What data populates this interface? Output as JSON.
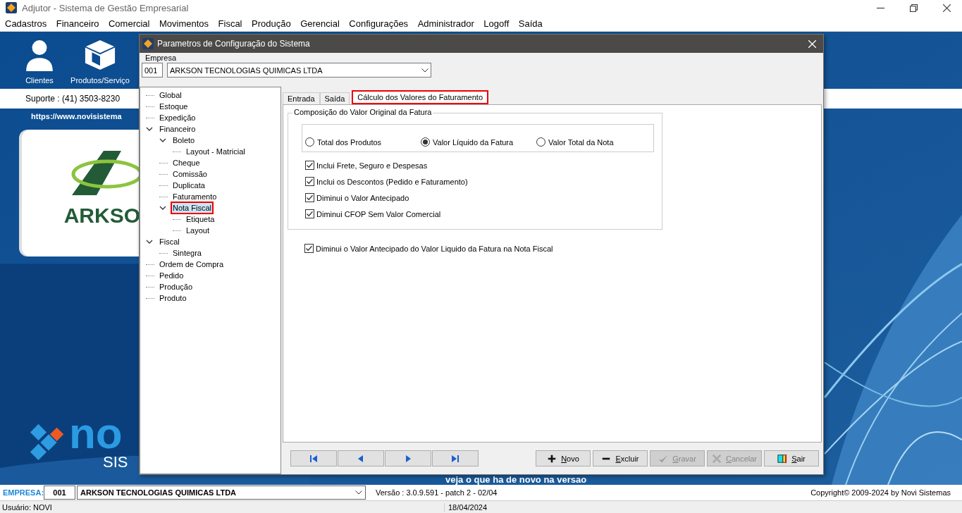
{
  "window": {
    "title": "Adjutor - Sistema de Gestão Empresarial"
  },
  "menu": [
    "Cadastros",
    "Financeiro",
    "Comercial",
    "Movimentos",
    "Fiscal",
    "Produção",
    "Gerencial",
    "Configurações",
    "Administrador",
    "Logoff",
    "Saída"
  ],
  "toolbar": [
    {
      "label": "Clientes",
      "kind": "person"
    },
    {
      "label": "Produtos/Serviço",
      "kind": "box"
    }
  ],
  "support": "Suporte : (41) 3503-8230",
  "website": "https://www.novisistema",
  "client_logo": {
    "text": "ARKSO"
  },
  "brand_logo": {
    "text": "no",
    "subtext": "SIS"
  },
  "news_link": "veja o que ha de novo na versao",
  "dialog": {
    "title": "Parametros de Configuração do Sistema",
    "empresa_label": "Empresa",
    "company_code": "001",
    "company_name": "ARKSON TECNOLOGIAS QUIMICAS LTDA",
    "tree": [
      {
        "label": "Global",
        "selected": false
      },
      {
        "label": "Estoque",
        "selected": false
      },
      {
        "label": "Expedição",
        "selected": false
      },
      {
        "label": "Financeiro",
        "selected": false,
        "expanded": true,
        "children": [
          {
            "label": "Boleto",
            "selected": false,
            "expanded": true,
            "children": [
              {
                "label": "Layout - Matricial",
                "selected": false
              }
            ]
          },
          {
            "label": "Cheque",
            "selected": false
          },
          {
            "label": "Comissão",
            "selected": false
          },
          {
            "label": "Duplicata",
            "selected": false
          },
          {
            "label": "Faturamento",
            "selected": false
          },
          {
            "label": "Nota Fiscal",
            "selected": true,
            "highlighted": true,
            "expanded": true,
            "children": [
              {
                "label": "Etiqueta",
                "selected": false
              },
              {
                "label": "Layout",
                "selected": false
              }
            ]
          }
        ]
      },
      {
        "label": "Fiscal",
        "selected": false,
        "expanded": true,
        "children": [
          {
            "label": "Sintegra",
            "selected": false
          }
        ]
      },
      {
        "label": "Ordem de Compra",
        "selected": false
      },
      {
        "label": "Pedido",
        "selected": false
      },
      {
        "label": "Produção",
        "selected": false
      },
      {
        "label": "Produto",
        "selected": false
      }
    ],
    "tabs": [
      {
        "label": "Entrada",
        "selected": false,
        "highlighted": false
      },
      {
        "label": "Saída",
        "selected": false,
        "highlighted": false
      },
      {
        "label": "Cálculo dos Valores do Faturamento",
        "selected": true,
        "highlighted": true
      }
    ],
    "group_title": "Composição do Valor Original da Fatura",
    "radios": [
      {
        "label": "Total dos Produtos",
        "selected": false
      },
      {
        "label": "Valor Líquido da Fatura",
        "selected": true
      },
      {
        "label": "Valor Total da Nota",
        "selected": false
      }
    ],
    "checkboxes": [
      {
        "label": "Inclui Frete, Seguro e Despesas",
        "checked": true
      },
      {
        "label": "Inclui os Descontos (Pedido e Faturamento)",
        "checked": true
      },
      {
        "label": "Diminui o Valor Antecipado",
        "checked": true
      },
      {
        "label": "Diminui CFOP Sem Valor Comercial",
        "checked": true
      }
    ],
    "extra_checkbox": {
      "label": "Diminui o Valor Antecipado do Valor Liquido da Fatura na Nota Fiscal",
      "checked": true
    },
    "nav_buttons": [
      {
        "kind": "first"
      },
      {
        "kind": "prev"
      },
      {
        "kind": "next"
      },
      {
        "kind": "last"
      }
    ],
    "action_buttons": [
      {
        "label": "Novo",
        "kind": "add",
        "disabled": false
      },
      {
        "label": "Excluir",
        "kind": "remove",
        "disabled": false
      },
      {
        "label": "Gravar",
        "kind": "save",
        "disabled": true
      },
      {
        "label": "Cancelar",
        "kind": "cancel",
        "disabled": true
      },
      {
        "label": "Sair",
        "kind": "exit",
        "disabled": false
      }
    ]
  },
  "bottom": {
    "company_label": "EMPRESA:",
    "company_code": "001",
    "company_name": "ARKSON TECNOLOGIAS QUIMICAS LTDA",
    "version": "Versão : 3.0.9.591 - patch 2 - 02/04",
    "copyright": "Copyright© 2009-2024 by Novi Sistemas"
  },
  "status": {
    "user": "Usuário: NOVI",
    "date": "18/04/2024"
  }
}
